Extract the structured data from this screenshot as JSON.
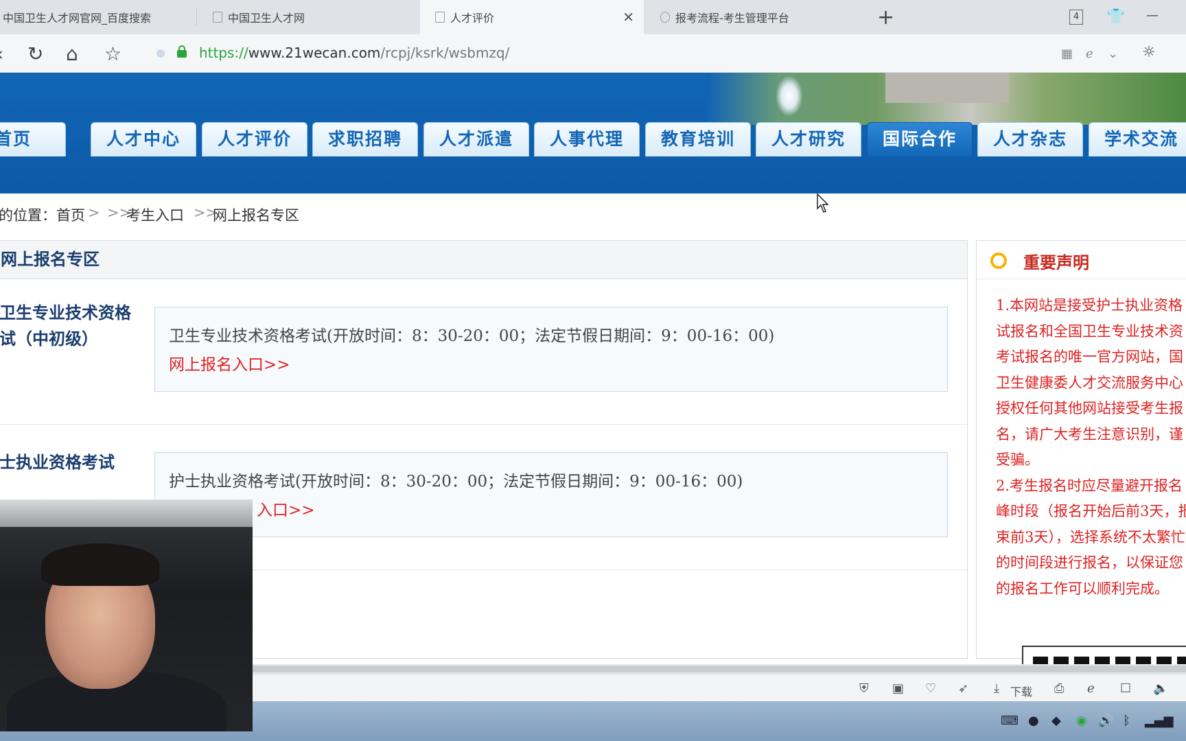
{
  "browser": {
    "tabs": [
      {
        "label": "中国卫生人才网官网_百度搜索"
      },
      {
        "label": "中国卫生人才网"
      },
      {
        "label": "人才评价"
      },
      {
        "label": "报考流程-考生管理平台"
      }
    ],
    "tab_count": "4",
    "url": {
      "protocol": "https://",
      "host": "www.21wecan.com",
      "path": "/rcpj/ksrk/wsbmzq/"
    }
  },
  "site": {
    "nav": [
      {
        "label": "首页"
      },
      {
        "label": "人才中心"
      },
      {
        "label": "人才评价"
      },
      {
        "label": "求职招聘"
      },
      {
        "label": "人才派遣"
      },
      {
        "label": "人事代理"
      },
      {
        "label": "教育培训"
      },
      {
        "label": "人才研究"
      },
      {
        "label": "国际合作"
      },
      {
        "label": "人才杂志"
      },
      {
        "label": "学术交流"
      }
    ],
    "active_nav": "国际合作"
  },
  "breadcrumb": {
    "prefix": "的位置：",
    "home": "首页",
    "sep1": ">",
    "sep2": ">>",
    "entry": "考生入口",
    "sep3": ">>",
    "current": "网上报名专区"
  },
  "main": {
    "title": "网上报名专区",
    "exams": [
      {
        "name_line1": "卫生专业技术资格",
        "name_line2": "试（中初级）",
        "desc": "卫生专业技术资格考试(开放时间：8：30-20：00；法定节假日期间：9：00-16：00)",
        "link": "网上报名入口>>"
      },
      {
        "name_line1": "士执业资格考试",
        "name_line2": "",
        "desc": "护士执业资格考试(开放时间：8：30-20：00；法定节假日期间：9：00-16：00)",
        "link": "入口>>"
      }
    ]
  },
  "notice": {
    "title": "重要声明",
    "text": "1.本网站是接受护士执业资格\n试报名和全国卫生专业技术资\n考试报名的唯一官方网站，国\n卫生健康委人才交流服务中心\n授权任何其他网站接受考生报\n名，请广大考生注意识别，谨\n受骗。\n2.考生报名时应尽量避开报名\n峰时段（报名开始后前3天，报\n束前3天），选择系统不太繁忙\n的时间段进行报名，以保证您\n的报名工作可以顺利完成。"
  },
  "statusbar": {
    "download_label": "下载"
  },
  "colors": {
    "header_blue": "#1266b5",
    "link_red": "#dd2222",
    "ssl_green": "#2aa33a",
    "notice_accent": "#f4b400"
  },
  "icons": [
    "page-icon",
    "close-icon",
    "plus-icon",
    "refresh-icon",
    "home-icon",
    "star-icon",
    "lock-icon",
    "qr-icon",
    "chevron-down-icon",
    "sun-icon",
    "shield-icon",
    "download-icon",
    "speaker-icon",
    "bluetooth-icon",
    "signal-icon"
  ]
}
